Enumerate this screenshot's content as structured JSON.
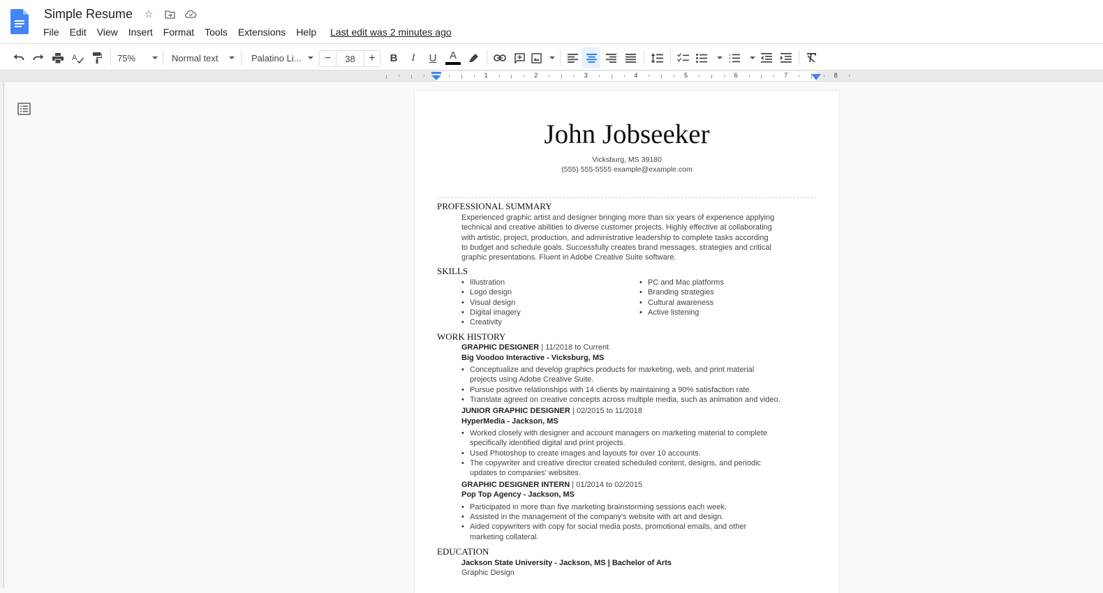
{
  "app": {
    "title": "Simple Resume",
    "menu": [
      "File",
      "Edit",
      "View",
      "Insert",
      "Format",
      "Tools",
      "Extensions",
      "Help"
    ],
    "last_edit": "Last edit was 2 minutes ago"
  },
  "toolbar": {
    "zoom": "75%",
    "style": "Normal text",
    "font": "Palatino Li...",
    "font_size": "38",
    "decrease": "−",
    "increase": "+",
    "active_alignment": "center",
    "accent_color": "#1a73e8",
    "text_color": "#000000"
  },
  "ruler": {
    "labels": [
      "1",
      "2",
      "3",
      "4",
      "5",
      "6",
      "7",
      "8"
    ]
  },
  "resume": {
    "name": "John Jobseeker",
    "address": "Vicksburg, MS 39180",
    "contact": "(555) 555-5555 example@example.com",
    "summary": {
      "heading": "PROFESSIONAL SUMMARY",
      "lines": [
        "Experienced graphic artist and designer bringing more than six years of experience applying",
        "technical and creative abilities to diverse customer projects. Highly effective at collaborating",
        "with artistic, project, production, and administrative leadership to complete tasks according",
        "to budget and schedule goals. Successfully creates brand messages, strategies and critical",
        "graphic presentations. Fluent in Adobe Creative Suite software."
      ]
    },
    "skills": {
      "heading": "SKILLS",
      "left": [
        "Illustration",
        "Logo design",
        "Visual design",
        "Digital imagery",
        "Creativity"
      ],
      "right": [
        "PC and Mac platforms",
        "Branding strategies",
        "Cultural awareness",
        "Active listening"
      ]
    },
    "work": {
      "heading": "WORK HISTORY",
      "jobs": [
        {
          "title": "GRAPHIC DESIGNER",
          "dates": " | 11/2018 to Current",
          "company": "Big Voodoo Interactive - Vicksburg, MS",
          "bullets": [
            [
              "Conceptualize and develop graphics products for marketing, web, and print material",
              "projects using Adobe Creative Suite."
            ],
            [
              "Pursue positive relationships with 14 clients by maintaining a 90% satisfaction rate."
            ],
            [
              "Translate agreed on creative concepts across multiple media, such as animation and video."
            ]
          ]
        },
        {
          "title": "JUNIOR GRAPHIC DESIGNER",
          "dates": " | 02/2015 to 11/2018",
          "company": "HyperMedia - Jackson, MS",
          "bullets": [
            [
              "Worked closely with designer and account managers on marketing material to complete",
              "specifically identified digital and print projects."
            ],
            [
              "Used Photoshop to create images and layouts for over 10 accounts."
            ],
            [
              "The copywriter and creative director created scheduled content, designs, and periodic",
              "updates to companies' websites."
            ]
          ]
        },
        {
          "title": "GRAPHIC DESIGNER INTERN",
          "dates": " | 01/2014 to 02/2015",
          "company": "Pop Top Agency - Jackson, MS",
          "bullets": [
            [
              "Participated in more than five marketing brainstorming sessions each week."
            ],
            [
              "Assisted in the management of the company's website with art and design."
            ],
            [
              "Aided copywriters with copy for social media posts, promotional emails, and other",
              "marketing collateral."
            ]
          ]
        }
      ]
    },
    "education": {
      "heading": "EDUCATION",
      "school": "Jackson State University - Jackson, MS | Bachelor of Arts",
      "field": "Graphic Design"
    }
  }
}
